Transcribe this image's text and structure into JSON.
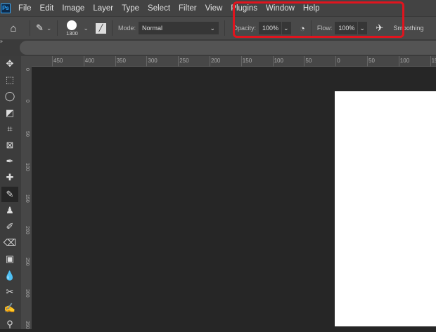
{
  "menubar": {
    "logo": "Ps",
    "items": [
      "File",
      "Edit",
      "Image",
      "Layer",
      "Type",
      "Select",
      "Filter",
      "View",
      "Plugins",
      "Window",
      "Help"
    ]
  },
  "options": {
    "brush_size": "1300",
    "mode_label": "Mode:",
    "mode_value": "Normal",
    "opacity_label": "Opacity:",
    "opacity_value": "100%",
    "flow_label": "Flow:",
    "flow_value": "100%",
    "smoothing_label": "Smoothing"
  },
  "ruler": {
    "horizontal": [
      "450",
      "400",
      "350",
      "300",
      "250",
      "200",
      "150",
      "100",
      "50",
      "0",
      "50",
      "100",
      "15"
    ],
    "vertical": [
      "0",
      "0",
      "50",
      "100",
      "150",
      "200",
      "250",
      "300",
      "350"
    ]
  },
  "tools": [
    "move-icon",
    "marquee-icon",
    "lasso-icon",
    "object-select-icon",
    "crop-icon",
    "frame-icon",
    "eyedropper-icon",
    "healing-brush-icon",
    "brush-icon",
    "clone-stamp-icon",
    "history-brush-icon",
    "eraser-icon",
    "gradient-icon",
    "blur-icon",
    "dodge-icon",
    "pen-icon",
    "zoom-icon"
  ],
  "active_tool": "brush-icon",
  "colors": {
    "highlight": "#e0141e",
    "canvas_bg": "#262626",
    "document": "#ffffff"
  }
}
